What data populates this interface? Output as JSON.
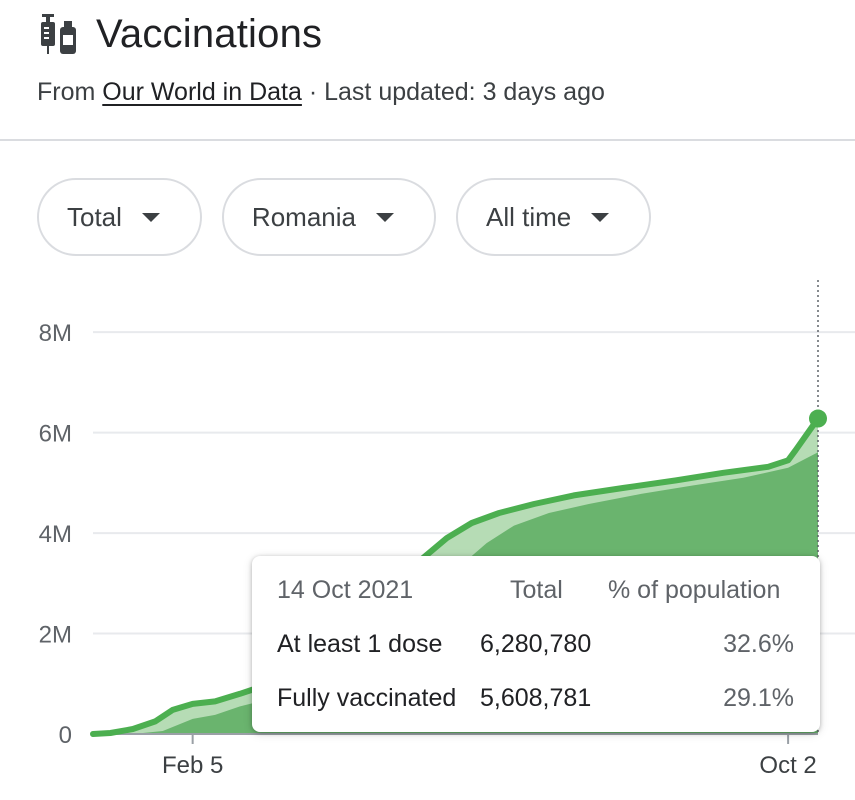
{
  "header": {
    "title": "Vaccinations",
    "icon": "vaccine-icon",
    "source_prefix": "From",
    "source_link": "Our World in Data",
    "updated": "· Last updated: 3 days ago"
  },
  "filters": [
    {
      "label": "Total"
    },
    {
      "label": "Romania"
    },
    {
      "label": "All time"
    }
  ],
  "colors": {
    "line": "#4caf50",
    "area_total": "#b6dcb5",
    "area_full": "#6ab46e",
    "grid": "#e8eaed"
  },
  "chart_data": {
    "type": "area",
    "ylim": [
      0,
      8800000
    ],
    "y_ticks": [
      0,
      2000000,
      4000000,
      6000000,
      8000000
    ],
    "y_tick_labels": [
      "0",
      "2M",
      "4M",
      "6M",
      "8M"
    ],
    "x_tick_labels": [
      {
        "date": "2021-02-05",
        "label": "Feb 5"
      },
      {
        "date": "2021-10-02",
        "label": "Oct 2"
      }
    ],
    "x_range": [
      "2020-12-27",
      "2021-10-14"
    ],
    "grid": true,
    "series": [
      {
        "name": "At least 1 dose",
        "points": [
          [
            "2020-12-27",
            0
          ],
          [
            "2021-01-03",
            20000
          ],
          [
            "2021-01-12",
            100000
          ],
          [
            "2021-01-21",
            250000
          ],
          [
            "2021-01-28",
            480000
          ],
          [
            "2021-02-05",
            600000
          ],
          [
            "2021-02-14",
            650000
          ],
          [
            "2021-02-24",
            800000
          ],
          [
            "2021-03-08",
            1000000
          ],
          [
            "2021-03-24",
            1500000
          ],
          [
            "2021-04-08",
            2100000
          ],
          [
            "2021-04-22",
            2800000
          ],
          [
            "2021-05-06",
            3400000
          ],
          [
            "2021-05-18",
            3900000
          ],
          [
            "2021-05-28",
            4200000
          ],
          [
            "2021-06-08",
            4400000
          ],
          [
            "2021-06-22",
            4580000
          ],
          [
            "2021-07-08",
            4750000
          ],
          [
            "2021-07-28",
            4900000
          ],
          [
            "2021-08-18",
            5050000
          ],
          [
            "2021-09-06",
            5200000
          ],
          [
            "2021-09-24",
            5320000
          ],
          [
            "2021-10-02",
            5450000
          ],
          [
            "2021-10-05",
            5650000
          ],
          [
            "2021-10-10",
            6000000
          ],
          [
            "2021-10-14",
            6280780
          ]
        ]
      },
      {
        "name": "Fully vaccinated",
        "points": [
          [
            "2020-12-27",
            0
          ],
          [
            "2021-01-12",
            0
          ],
          [
            "2021-01-24",
            60000
          ],
          [
            "2021-02-05",
            300000
          ],
          [
            "2021-02-14",
            380000
          ],
          [
            "2021-02-24",
            550000
          ],
          [
            "2021-03-08",
            700000
          ],
          [
            "2021-03-24",
            1000000
          ],
          [
            "2021-04-08",
            1450000
          ],
          [
            "2021-04-22",
            1950000
          ],
          [
            "2021-05-06",
            2500000
          ],
          [
            "2021-05-20",
            3200000
          ],
          [
            "2021-06-03",
            3800000
          ],
          [
            "2021-06-14",
            4150000
          ],
          [
            "2021-06-28",
            4400000
          ],
          [
            "2021-07-14",
            4580000
          ],
          [
            "2021-08-04",
            4780000
          ],
          [
            "2021-08-25",
            4950000
          ],
          [
            "2021-09-14",
            5100000
          ],
          [
            "2021-10-02",
            5300000
          ],
          [
            "2021-10-14",
            5608781
          ]
        ]
      }
    ],
    "tooltip": {
      "date": "14 Oct 2021",
      "col_total": "Total",
      "col_pct": "% of population",
      "rows": [
        {
          "label": "At least 1 dose",
          "total": "6,280,780",
          "pct": "32.6%"
        },
        {
          "label": "Fully vaccinated",
          "total": "5,608,781",
          "pct": "29.1%"
        }
      ]
    }
  }
}
